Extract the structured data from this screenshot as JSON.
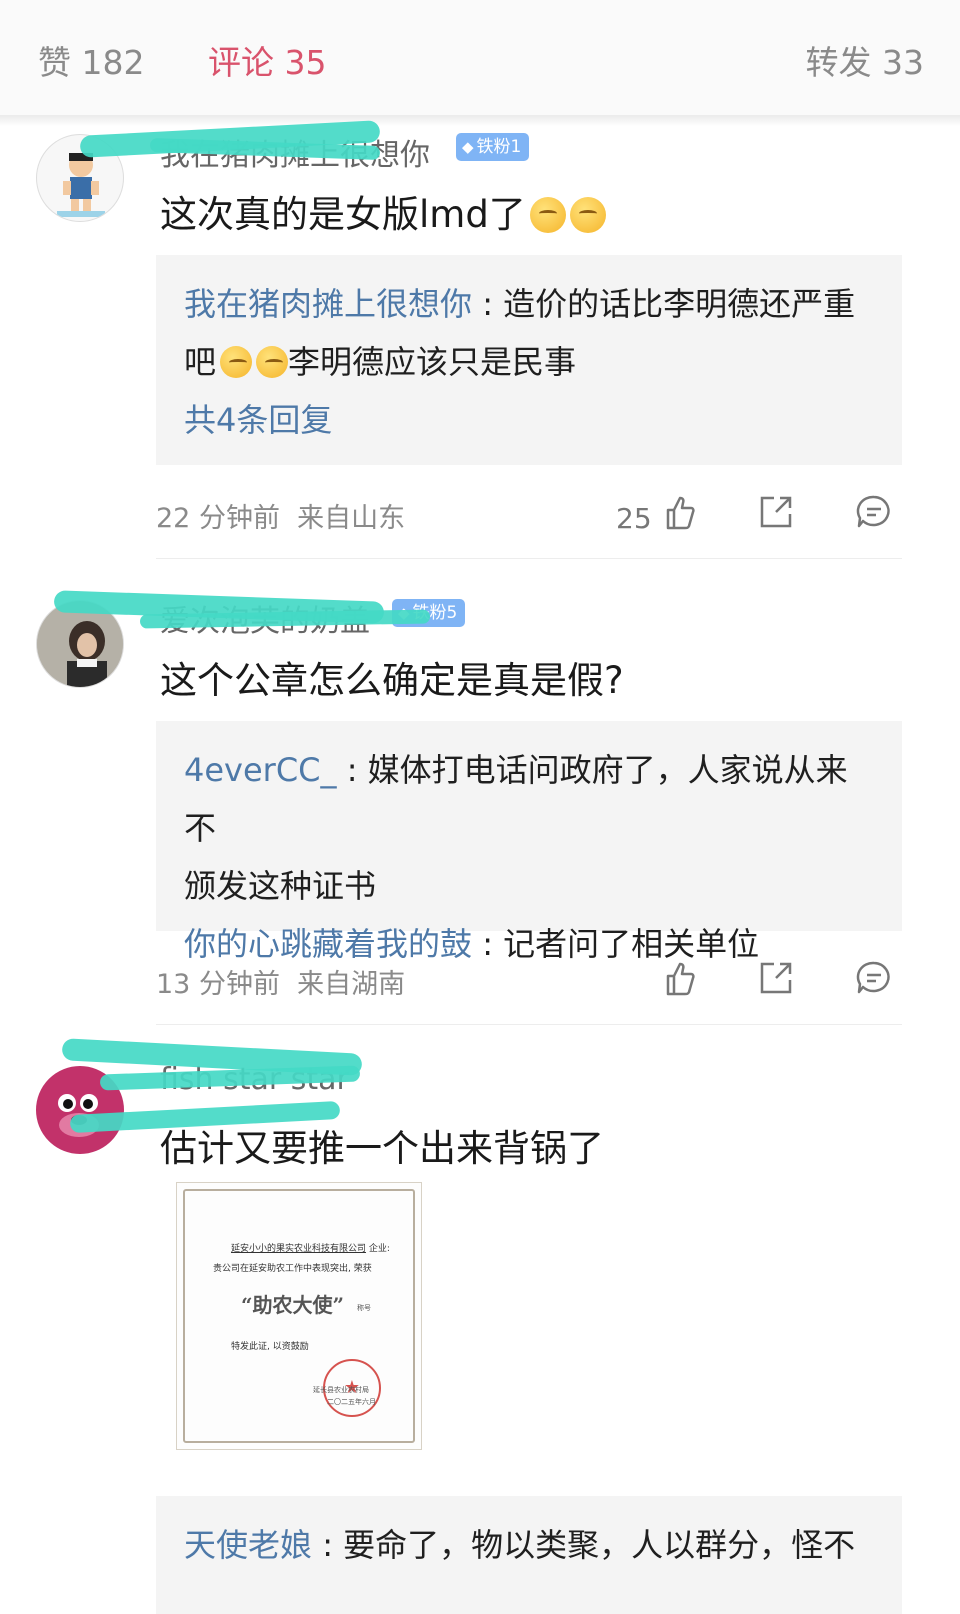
{
  "tabs": {
    "likes": "赞 182",
    "comments": "评论 35",
    "reposts": "转发 33"
  },
  "comments": [
    {
      "username": "我在猪肉摊上很想你",
      "badge": "铁粉1",
      "text": "这次真的是女版lmd了",
      "replies": [
        {
          "user": "我在猪肉摊上很想你",
          "text_a": "造价的话比李明德还严重",
          "text_b": "吧",
          "text_c": "李明德应该只是民事"
        }
      ],
      "more_replies": "共4条回复",
      "time": "22 分钟前",
      "location": "来自山东",
      "like_count": "25"
    },
    {
      "username": "爱次泡芙的奶盖",
      "badge": "铁粉5",
      "text": "这个公章怎么确定是真是假?",
      "replies": [
        {
          "user": "4everCC_",
          "text_a": "媒体打电话问政府了，人家说从来不",
          "text_b": "颁发这种证书"
        },
        {
          "user": "你的心跳藏着我的鼓",
          "text": "记者问了相关单位"
        }
      ],
      "time": "13 分钟前",
      "location": "来自湖南"
    },
    {
      "username": "fish star star",
      "text": "估计又要推一个出来背锅了",
      "image": {
        "company": "延安小小的果实农业科技有限公司",
        "suffix": "企业:",
        "line1": "贵公司在延安助农工作中表现突出, 荣获",
        "title": "“助农大使”",
        "title_suffix": "称号",
        "line2": "特发此证, 以资鼓励",
        "issuer": "延长县农业农村局",
        "date": "二〇二五年六月",
        "seal_char": "★"
      },
      "replies": [
        {
          "user": "天使老娘",
          "text": "要命了，物以类聚，人以群分，怪不"
        }
      ]
    }
  ],
  "colors": {
    "accent": "#d9536c",
    "link": "#4e79a8",
    "badge": "#7fb4f5",
    "scribble": "#44d9c6"
  }
}
